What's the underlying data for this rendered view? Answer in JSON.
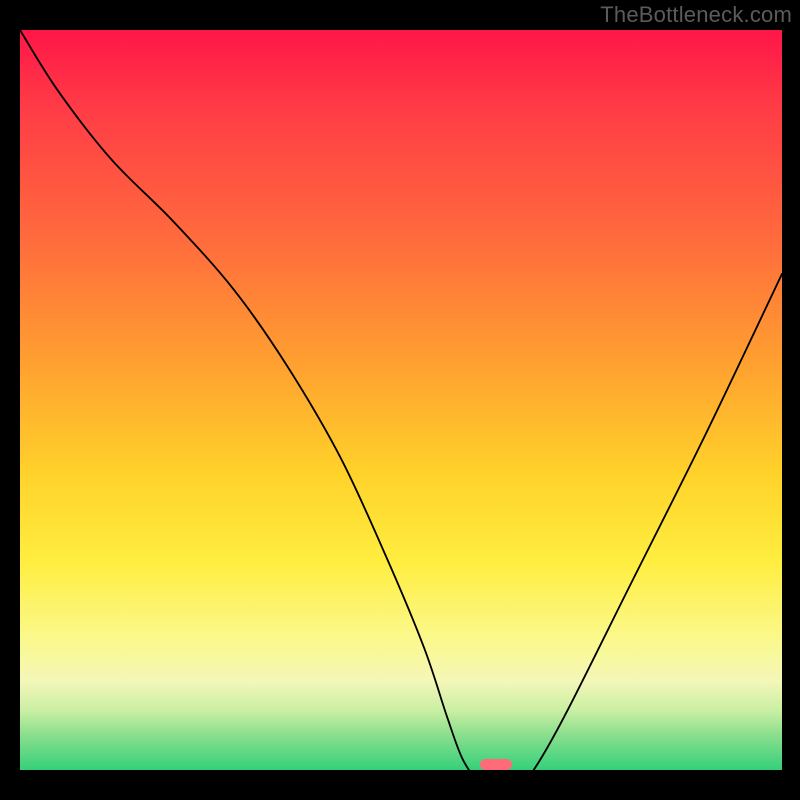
{
  "watermark": "TheBottleneck.com",
  "chart_data": {
    "type": "line",
    "title": "",
    "xlabel": "",
    "ylabel": "",
    "xlim": [
      0,
      100
    ],
    "ylim": [
      0,
      100
    ],
    "series": [
      {
        "name": "bottleneck-curve",
        "x": [
          0,
          5,
          12,
          20,
          28,
          35,
          42,
          48,
          53,
          56,
          58,
          60,
          61.5,
          63.5,
          66,
          68,
          72,
          80,
          90,
          100
        ],
        "values": [
          100,
          92,
          83,
          75,
          66,
          56,
          44,
          31,
          19,
          10,
          4.5,
          1.5,
          0.6,
          0.6,
          1.4,
          3.8,
          11,
          27,
          47,
          68
        ]
      }
    ],
    "optimum_marker": {
      "x": 62.5,
      "width_pct": 4.2,
      "height_pct": 1.5
    },
    "gradient_stops": [
      {
        "pct": 0,
        "color": "#ff1648"
      },
      {
        "pct": 10,
        "color": "#ff3a46"
      },
      {
        "pct": 28,
        "color": "#ff6a3d"
      },
      {
        "pct": 45,
        "color": "#ffa030"
      },
      {
        "pct": 60,
        "color": "#ffd22a"
      },
      {
        "pct": 72,
        "color": "#ffee40"
      },
      {
        "pct": 82,
        "color": "#fbf88a"
      },
      {
        "pct": 88,
        "color": "#f4f7b8"
      },
      {
        "pct": 92,
        "color": "#c9efa3"
      },
      {
        "pct": 95,
        "color": "#8fe08f"
      },
      {
        "pct": 100,
        "color": "#35d07a"
      }
    ]
  }
}
